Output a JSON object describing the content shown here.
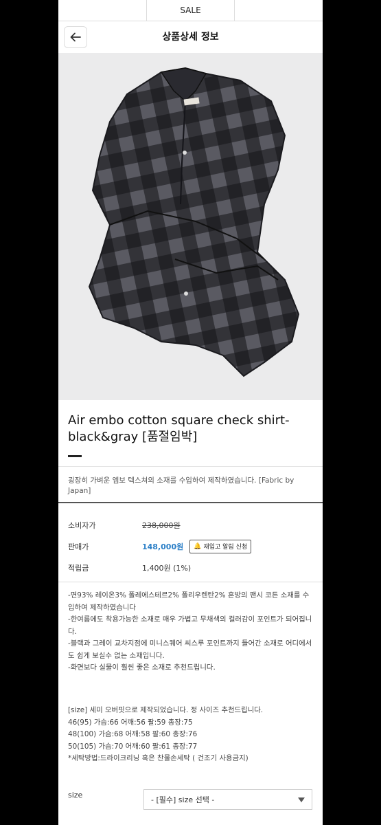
{
  "topnav": {
    "tabs": [
      "",
      "SALE",
      ""
    ]
  },
  "header": {
    "title": "상품상세 정보"
  },
  "product": {
    "title": "Air embo cotton square check shirt-black&gray [품절임박]",
    "description": "굉장히 가벼운 엠보 텍스쳐의 소재를 수입하여 제작하였습니다. [Fabric by Japan]"
  },
  "pricing": {
    "consumer_label": "소비자가",
    "consumer_price": "238,000원",
    "sale_label": "판매가",
    "sale_price": "148,000원",
    "notify_label": "재입고 알림 신청",
    "points_label": "적립금",
    "points_value": "1,400원 (1%)",
    "sale_color": "#2b7fc7"
  },
  "details": [
    "-면93% 레이온3% 폴레에스테르2% 폴리우렌탄2% 혼방의 팬시 코튼 소재를 수입하여 제작하였습니다",
    "-한여름에도 착용가능한 소재로 매우 가볍고 무채색의 컬러감이 포인트가 되어집니다.",
    "-블랙과 그레이 교차지점에 미니스퀘어 씨스루 포인트까지 들어간 소재로 어디에서도 쉽게 보실수 없는 소재입니다.",
    "-화면보다 실물이 훨씬 좋은 소재로 추천드립니다."
  ],
  "size_info": [
    "[size] 세미 오버핏으로 제작되었습니다. 정 사이즈 추천드립니다.",
    "46(95) 가슴:66 어깨:56 팔:59 총장:75",
    "48(100) 가슴:68 어깨:58 팔:60 총장:76",
    "50(105) 가슴:70 어깨:60 팔:61 총장:77",
    "*세탁방법:드라이크리닝 혹은 찬물손세탁 ( 건조기 사용금지)"
  ],
  "size_select": {
    "label": "size",
    "selected": "- [필수] size 선택 -"
  },
  "icons": {
    "back": "arrow-left-icon",
    "notify": "bell-icon",
    "dropdown": "chevron-down-icon"
  }
}
